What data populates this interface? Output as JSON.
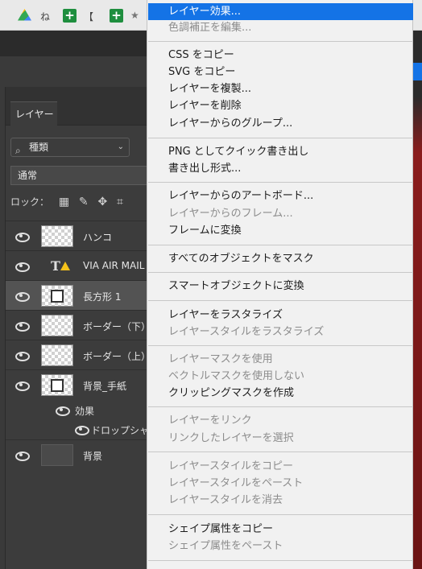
{
  "toolbar": {
    "bookmark_char": "ね",
    "bracket_char": "【",
    "plus_char": "+"
  },
  "layers_panel": {
    "tab_label": "レイヤー",
    "search_label": "種類",
    "blend_mode": "通常",
    "lock_label": "ロック：",
    "layers": [
      {
        "name": "ハンコ",
        "thumb": "checker"
      },
      {
        "name": "VIA AIR MAIL",
        "thumb": "text"
      },
      {
        "name": "長方形 1",
        "thumb": "shape",
        "selected": true
      },
      {
        "name": "ボーダー（下）",
        "thumb": "checker"
      },
      {
        "name": "ボーダー（上）",
        "thumb": "checker"
      },
      {
        "name": "背景_手紙",
        "thumb": "shape"
      }
    ],
    "effects_label": "効果",
    "drop_shadow_label": "ドロップシャド",
    "background_layer": "背景"
  },
  "context_menu": {
    "items": [
      {
        "label": "レイヤー効果...",
        "state": "highlighted"
      },
      {
        "label": "色調補正を編集...",
        "state": "disabled"
      },
      {
        "label": "CSS をコピー",
        "state": "enabled"
      },
      {
        "label": "SVG をコピー",
        "state": "enabled"
      },
      {
        "label": "レイヤーを複製...",
        "state": "enabled"
      },
      {
        "label": "レイヤーを削除",
        "state": "enabled"
      },
      {
        "label": "レイヤーからのグループ...",
        "state": "enabled"
      },
      {
        "label": "PNG としてクイック書き出し",
        "state": "enabled"
      },
      {
        "label": "書き出し形式...",
        "state": "enabled"
      },
      {
        "label": "レイヤーからのアートボード...",
        "state": "enabled"
      },
      {
        "label": "レイヤーからのフレーム...",
        "state": "disabled"
      },
      {
        "label": "フレームに変換",
        "state": "enabled"
      },
      {
        "label": "すべてのオブジェクトをマスク",
        "state": "enabled"
      },
      {
        "label": "スマートオブジェクトに変換",
        "state": "enabled"
      },
      {
        "label": "レイヤーをラスタライズ",
        "state": "enabled"
      },
      {
        "label": "レイヤースタイルをラスタライズ",
        "state": "disabled"
      },
      {
        "label": "レイヤーマスクを使用",
        "state": "disabled"
      },
      {
        "label": "ベクトルマスクを使用しない",
        "state": "disabled"
      },
      {
        "label": "クリッピングマスクを作成",
        "state": "enabled"
      },
      {
        "label": "レイヤーをリンク",
        "state": "disabled"
      },
      {
        "label": "リンクしたレイヤーを選択",
        "state": "disabled"
      },
      {
        "label": "レイヤースタイルをコピー",
        "state": "disabled"
      },
      {
        "label": "レイヤースタイルをペースト",
        "state": "disabled"
      },
      {
        "label": "レイヤースタイルを消去",
        "state": "disabled"
      },
      {
        "label": "シェイプ属性をコピー",
        "state": "enabled"
      },
      {
        "label": "シェイプ属性をペースト",
        "state": "disabled"
      }
    ]
  },
  "colors": {
    "highlight": "#1473e6",
    "menu_bg": "#f1f1f1",
    "disabled_text": "#8c8c8c",
    "panel_bg": "#3c3c3c"
  }
}
